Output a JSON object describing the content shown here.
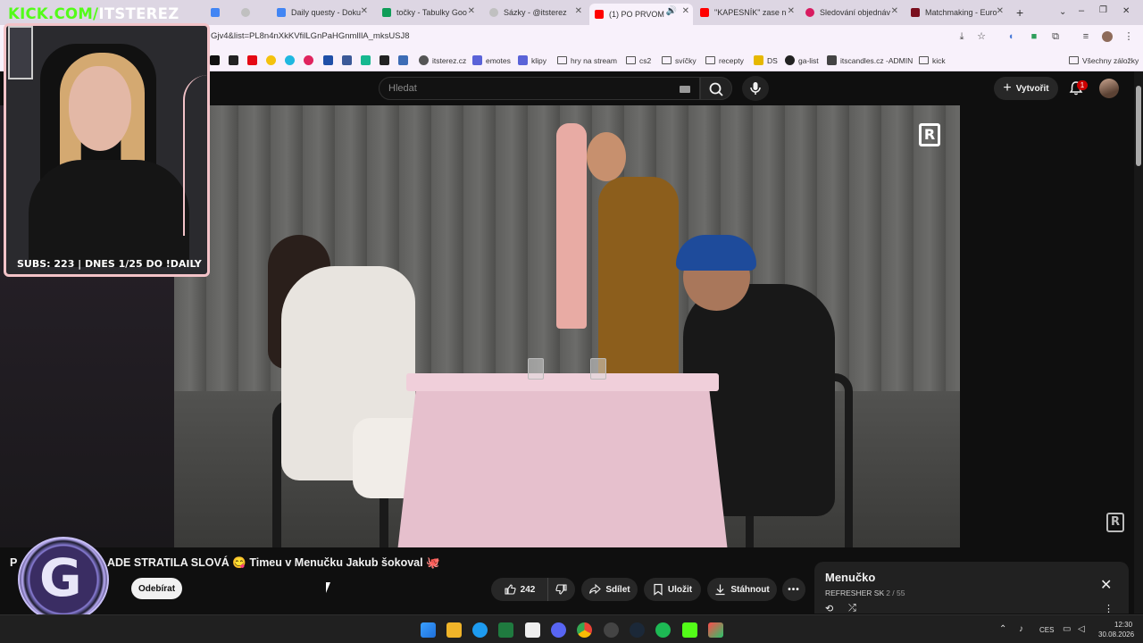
{
  "browser": {
    "tabs": [
      {
        "label": "",
        "icon": "docs-icon",
        "color": "#4285f4"
      },
      {
        "label": "",
        "icon": "globe-icon",
        "color": "#c0c0c0"
      },
      {
        "label": "Daily questy - Doku",
        "icon": "docs-icon",
        "color": "#4285f4"
      },
      {
        "label": "točky - Tabulky Goo",
        "icon": "sheets-icon",
        "color": "#0f9d58"
      },
      {
        "label": "Sázky - @itsterez",
        "icon": "globe-icon",
        "color": "#c0c0c0"
      },
      {
        "label": "(1) PO PRVOM",
        "icon": "youtube-icon",
        "color": "#ff0000"
      },
      {
        "label": "\"KAPESNÍK\" zase n",
        "icon": "youtube-icon",
        "color": "#ff0000"
      },
      {
        "label": "Sledování objednáv",
        "icon": "app-icon",
        "color": "#d81b60"
      },
      {
        "label": "Matchmaking - Euro",
        "icon": "faceit-icon",
        "color": "#7a0f1e"
      }
    ],
    "new_tab": "+",
    "window_controls": [
      "⌄",
      "–",
      "❐",
      "✕"
    ],
    "url": "Gjv4&list=PL8n4nXkKVfilLGnPaHGnmlIlA_mksUSJ8",
    "bookmarks": [
      {
        "label": "",
        "icon": "x-icon",
        "color": "#111111"
      },
      {
        "label": "",
        "icon": "tiktok-icon",
        "color": "#222222"
      },
      {
        "label": "",
        "icon": "netflix-icon",
        "color": "#e50914"
      },
      {
        "label": "",
        "icon": "yellow-app-icon",
        "color": "#f4c20d"
      },
      {
        "label": "",
        "icon": "cyan-app-icon",
        "color": "#1fb8e0"
      },
      {
        "label": "",
        "icon": "red-circle-icon",
        "color": "#e0245e"
      },
      {
        "label": "",
        "icon": "paypal-icon",
        "color": "#1f4fa8"
      },
      {
        "label": "",
        "icon": "fb-icon",
        "color": "#3b5998"
      },
      {
        "label": "",
        "icon": "green-t-icon",
        "color": "#17b890"
      },
      {
        "label": "",
        "icon": "download-icon",
        "color": "#222222"
      },
      {
        "label": "",
        "icon": "pen-icon",
        "color": "#3d6cb5"
      },
      {
        "label": "itsterez.cz",
        "icon": "globe-icon",
        "color": "#555555"
      },
      {
        "label": "emotes",
        "icon": "sl-icon",
        "color": "#5a63d8"
      },
      {
        "label": "klipy",
        "icon": "sl-icon",
        "color": "#5a63d8"
      },
      {
        "label": "hry na stream",
        "icon": "folder-icon",
        "color": ""
      },
      {
        "label": "cs2",
        "icon": "folder-icon",
        "color": ""
      },
      {
        "label": "svíčky",
        "icon": "folder-icon",
        "color": ""
      },
      {
        "label": "recepty",
        "icon": "folder-icon",
        "color": ""
      },
      {
        "label": "DS",
        "icon": "ds-icon",
        "color": "#e6b800"
      },
      {
        "label": "ga-list",
        "icon": "github-icon",
        "color": "#222222"
      },
      {
        "label": "itscandles.cz -ADMIN",
        "icon": "candle-icon",
        "color": "#444444"
      },
      {
        "label": "kick",
        "icon": "folder-icon",
        "color": ""
      }
    ],
    "all_bookmarks": "Všechny záložky"
  },
  "youtube": {
    "search_placeholder": "Hledat",
    "create_label": "Vytvořit",
    "notification_count": "1",
    "video_title_prefix": "P",
    "video_title": "ADE STRATILA SLOVÁ 😋 Timeu v Menučku Jakub šokoval 🐙",
    "subscribe_label": "Odebírat",
    "like_count": "242",
    "share_label": "Sdílet",
    "save_label": "Uložit",
    "download_label": "Stáhnout",
    "playlist": {
      "title": "Menučko",
      "channel": "REFRESHER SK",
      "position": "- 2 / 55"
    },
    "brand_mark": "R"
  },
  "stream_overlay": {
    "kick_prefix": "KICK.COM/",
    "kick_handle": "ITSTEREZ",
    "subs_text": "SUBS: 223 | DNES 1/25 DO !DAILY",
    "logo_letter": "G"
  },
  "taskbar": {
    "language": "CES",
    "time": "12:30",
    "date": "30.08.2026"
  },
  "colors": {
    "kick_green": "#53fc18",
    "overlay_pink": "#f3c3c8",
    "youtube_dark": "#0f0f0f"
  }
}
